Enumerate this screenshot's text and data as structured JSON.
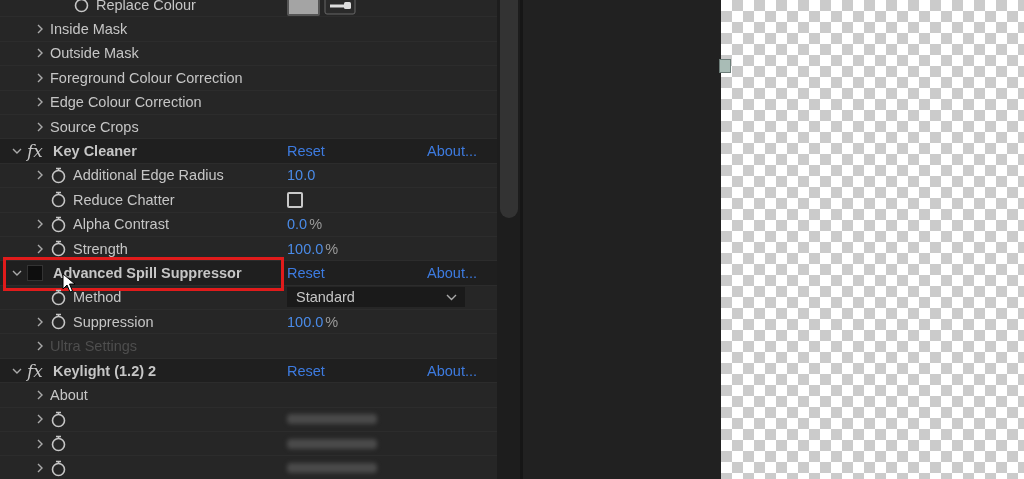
{
  "effect_controls": {
    "items": [
      {
        "kind": "hidden",
        "children": [
          {
            "kind": "hidden",
            "children": [
              {
                "kind": "color-property",
                "label": "Replace Colour",
                "color": "#a4a4a4"
              }
            ]
          },
          {
            "kind": "group",
            "label": "Inside Mask",
            "expanded": false,
            "disabled": false
          },
          {
            "kind": "group",
            "label": "Outside Mask",
            "expanded": false,
            "disabled": false
          },
          {
            "kind": "group",
            "label": "Foreground Colour Correction",
            "expanded": false,
            "disabled": false
          },
          {
            "kind": "group",
            "label": "Edge Colour Correction",
            "expanded": false,
            "disabled": false
          },
          {
            "kind": "group",
            "label": "Source Crops",
            "expanded": false,
            "disabled": false
          }
        ]
      },
      {
        "kind": "effect",
        "fx": "fx",
        "label": "Key Cleaner",
        "expanded": true,
        "highlighted": false,
        "reset": "Reset",
        "about": "About...",
        "children": [
          {
            "kind": "number-property",
            "label": "Additional Edge Radius",
            "expanded": false,
            "value": "10.0"
          },
          {
            "kind": "checkbox-property",
            "label": "Reduce Chatter",
            "checked": false
          },
          {
            "kind": "number-property",
            "label": "Alpha Contrast",
            "expanded": false,
            "value": "0.0",
            "unit": "%"
          },
          {
            "kind": "number-property",
            "label": "Strength",
            "expanded": false,
            "value": "100.0",
            "unit": "%"
          }
        ]
      },
      {
        "kind": "effect",
        "label": "Advanced Spill Suppressor",
        "expanded": true,
        "highlighted": true,
        "reset": "Reset",
        "about": "About...",
        "children": [
          {
            "kind": "dropdown-property",
            "label": "Method",
            "value": "Standard"
          },
          {
            "kind": "number-property",
            "label": "Suppression",
            "expanded": false,
            "value": "100.0",
            "unit": "%"
          },
          {
            "kind": "group",
            "label": "Ultra Settings",
            "expanded": false,
            "disabled": true
          }
        ]
      },
      {
        "kind": "effect",
        "fx": "fx",
        "label": "Keylight (1.2) 2",
        "expanded": true,
        "highlighted": false,
        "reset": "Reset",
        "about": "About...",
        "children": [
          {
            "kind": "group",
            "label": "About",
            "expanded": false,
            "disabled": false
          },
          {
            "kind": "blurred-property",
            "expanded": false
          },
          {
            "kind": "blurred-property",
            "expanded": false
          },
          {
            "kind": "blurred-property",
            "expanded": false
          }
        ]
      }
    ]
  }
}
